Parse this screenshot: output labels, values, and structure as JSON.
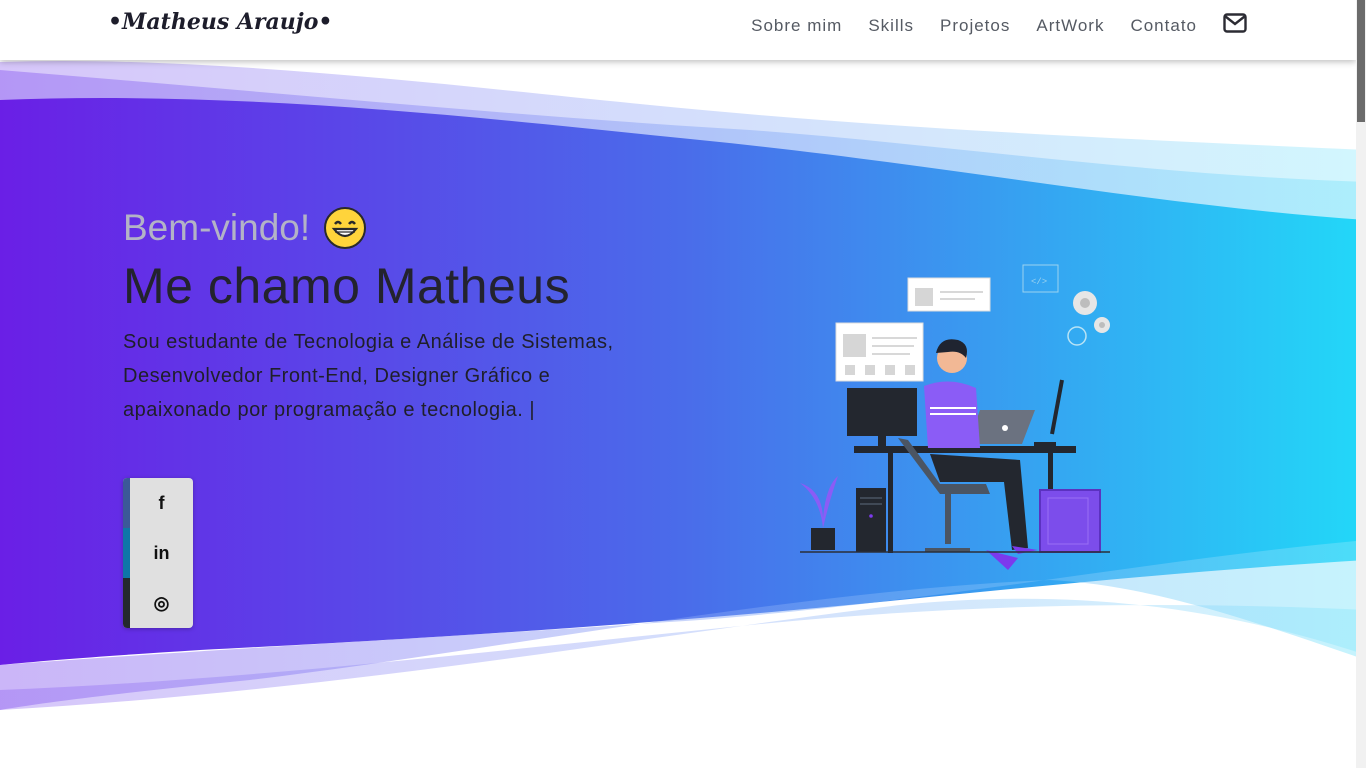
{
  "nav": {
    "logo": "•Matheus Araujo•",
    "links": [
      "Sobre mim",
      "Skills",
      "Projetos",
      "ArtWork",
      "Contato"
    ],
    "mail_icon": "envelope-icon"
  },
  "hero": {
    "greeting": "Bem-vindo!",
    "greeting_emoji": "grinning-face-emoji",
    "headline": "Me chamo Matheus",
    "bio": "Sou estudante de Tecnologia e Análise de Sistemas, Desenvolvedor Front-End, Designer Gráfico e apaixonado por programação e tecnologia. |"
  },
  "social": [
    {
      "label": "f",
      "icon": "facebook-icon",
      "color": "#3b5998"
    },
    {
      "label": "in",
      "icon": "linkedin-icon",
      "color": "#0e76a8"
    },
    {
      "label": "◎",
      "icon": "github-icon",
      "color": "#24292e"
    }
  ],
  "colors": {
    "gradient_start": "#6a1fe6",
    "gradient_end": "#22d8f8",
    "text_dark": "#23232e",
    "greeting": "#b3b3c6"
  }
}
